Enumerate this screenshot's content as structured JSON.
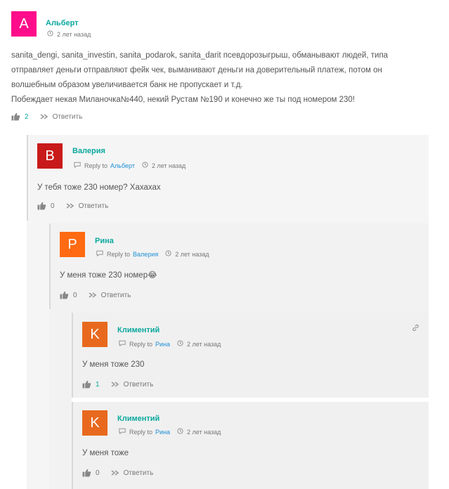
{
  "comments": [
    {
      "author": "Альберт",
      "avatar_letter": "A",
      "avatar_color": "#ff0d8a",
      "time": "2 лет назад",
      "text_lines": [
        "sanita_dengi, sanita_investin, sanita_podarok, sanita_darit псевдорозыгрыш, обманывают людей, типа",
        "отправляет деньги отправляют фейк чек, выманивают деньги на доверительный платеж, потом он",
        "волшебным образом увеличивается банк не пропускает и т.д.",
        "Побеждает некая Миланочка№440, некий Рустам №190 и конечно же ты под номером 230!"
      ],
      "likes": "2",
      "reply_label": "Ответить"
    },
    {
      "author": "Валерия",
      "avatar_letter": "B",
      "avatar_color": "#c81a1a",
      "reply_to_label": "Reply to",
      "reply_to": "Альберт",
      "time": "2 лет назад",
      "text": "У тебя тоже 230 номер? Хахахах",
      "likes": "0",
      "reply_label": "Ответить"
    },
    {
      "author": "Рина",
      "avatar_letter": "P",
      "avatar_color": "#ff6a13",
      "reply_to_label": "Reply to",
      "reply_to": "Валерия",
      "time": "2 лет назад",
      "text": "У меня тоже 230 номер😂",
      "likes": "0",
      "reply_label": "Ответить"
    },
    {
      "author": "Климентий",
      "avatar_letter": "K",
      "avatar_color": "#e8691e",
      "reply_to_label": "Reply to",
      "reply_to": "Рина",
      "time": "2 лет назад",
      "text": "У меня тоже 230",
      "likes": "1",
      "reply_label": "Ответить"
    },
    {
      "author": "Климентий",
      "avatar_letter": "K",
      "avatar_color": "#e8691e",
      "reply_to_label": "Reply to",
      "reply_to": "Рина",
      "time": "2 лет назад",
      "text": "У меня тоже",
      "likes": "0",
      "reply_label": "Ответить"
    }
  ],
  "icons": {
    "clock": "clock-icon",
    "reply_to": "reply-to-icon",
    "like": "thumbs-up-icon",
    "reply": "reply-arrow-icon",
    "permalink": "link-icon"
  }
}
